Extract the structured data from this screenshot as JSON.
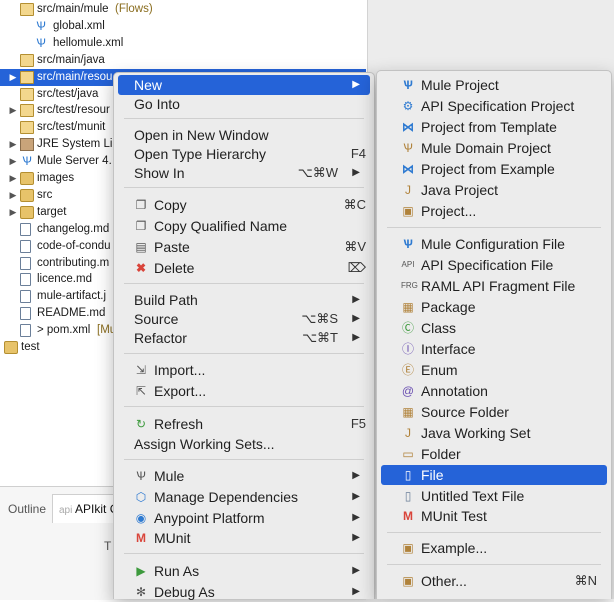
{
  "tree": {
    "rows": [
      {
        "label": "src/main/mule",
        "suffix": " (Flows)",
        "kind": "pkg",
        "arrow": ""
      },
      {
        "label": "global.xml",
        "suffix": "",
        "kind": "mule",
        "arrow": ""
      },
      {
        "label": "hellomule.xml",
        "suffix": "",
        "kind": "mule",
        "arrow": ""
      },
      {
        "label": "src/main/java",
        "suffix": "",
        "kind": "pkg",
        "arrow": ""
      },
      {
        "label": "src/main/resou",
        "suffix": "",
        "kind": "pkg",
        "arrow": "▶"
      },
      {
        "label": "src/test/java",
        "suffix": "",
        "kind": "pkg",
        "arrow": ""
      },
      {
        "label": "src/test/resour",
        "suffix": "",
        "kind": "pkg",
        "arrow": "▶"
      },
      {
        "label": "src/test/munit",
        "suffix": "",
        "kind": "pkg",
        "arrow": ""
      },
      {
        "label": "JRE System Li",
        "suffix": "",
        "kind": "jre",
        "arrow": "▶"
      },
      {
        "label": "Mule Server 4.",
        "suffix": "",
        "kind": "mule",
        "arrow": "▶"
      },
      {
        "label": "images",
        "suffix": "",
        "kind": "folder",
        "arrow": "▶"
      },
      {
        "label": "src",
        "suffix": "",
        "kind": "folder",
        "arrow": "▶"
      },
      {
        "label": "target",
        "suffix": "",
        "kind": "folder",
        "arrow": "▶"
      },
      {
        "label": "changelog.md",
        "suffix": "",
        "kind": "file",
        "arrow": ""
      },
      {
        "label": "code-of-condu",
        "suffix": "",
        "kind": "file",
        "arrow": ""
      },
      {
        "label": "contributing.m",
        "suffix": "",
        "kind": "file",
        "arrow": ""
      },
      {
        "label": "licence.md",
        "suffix": "",
        "kind": "file",
        "arrow": ""
      },
      {
        "label": "mule-artifact.j",
        "suffix": "",
        "kind": "file",
        "arrow": ""
      },
      {
        "label": "README.md",
        "suffix": "",
        "kind": "file",
        "arrow": ""
      },
      {
        "label": "> pom.xml",
        "suffix": " [Mu",
        "kind": "file",
        "arrow": ""
      },
      {
        "label": "test",
        "suffix": "",
        "kind": "folder",
        "arrow": ""
      }
    ]
  },
  "bottom": {
    "tab_outline": "Outline",
    "tab_apikit_prefix": "api",
    "tab_apikit": "APIkit C",
    "hint": "T"
  },
  "context_menu": {
    "new": "New",
    "go_into": "Go Into",
    "open_new_window": "Open in New Window",
    "open_type_hierarchy": "Open Type Hierarchy",
    "open_type_hierarchy_sc": "F4",
    "show_in": "Show In",
    "show_in_sc": "⌥⌘W",
    "copy": "Copy",
    "copy_sc": "⌘C",
    "copy_qualified": "Copy Qualified Name",
    "paste": "Paste",
    "paste_sc": "⌘V",
    "delete": "Delete",
    "delete_sc": "⌦",
    "build_path": "Build Path",
    "source": "Source",
    "source_sc": "⌥⌘S",
    "refactor": "Refactor",
    "refactor_sc": "⌥⌘T",
    "import": "Import...",
    "export": "Export...",
    "refresh": "Refresh",
    "refresh_sc": "F5",
    "assign_working_sets": "Assign Working Sets...",
    "mule": "Mule",
    "manage_dependencies": "Manage Dependencies",
    "anypoint_platform": "Anypoint Platform",
    "munit": "MUnit",
    "run_as": "Run As",
    "debug_as": "Debug As"
  },
  "new_submenu": {
    "mule_project": "Mule Project",
    "api_spec_project": "API Specification Project",
    "project_from_template": "Project from Template",
    "mule_domain_project": "Mule Domain Project",
    "project_from_example": "Project from Example",
    "java_project": "Java Project",
    "project": "Project...",
    "mule_config_file": "Mule Configuration File",
    "api_spec_file": "API Specification File",
    "raml_fragment": "RAML API Fragment File",
    "package": "Package",
    "class": "Class",
    "interface": "Interface",
    "enum": "Enum",
    "annotation": "Annotation",
    "source_folder": "Source Folder",
    "java_working_set": "Java Working Set",
    "folder": "Folder",
    "file": "File",
    "untitled_text_file": "Untitled Text File",
    "munit_test": "MUnit Test",
    "example": "Example...",
    "other": "Other...",
    "other_sc": "⌘N"
  },
  "icons": {
    "arrow_right": "▶",
    "submenu_arrow": "▶"
  },
  "colors": {
    "selection": "#2563d8",
    "menu_bg": "#ececec"
  }
}
